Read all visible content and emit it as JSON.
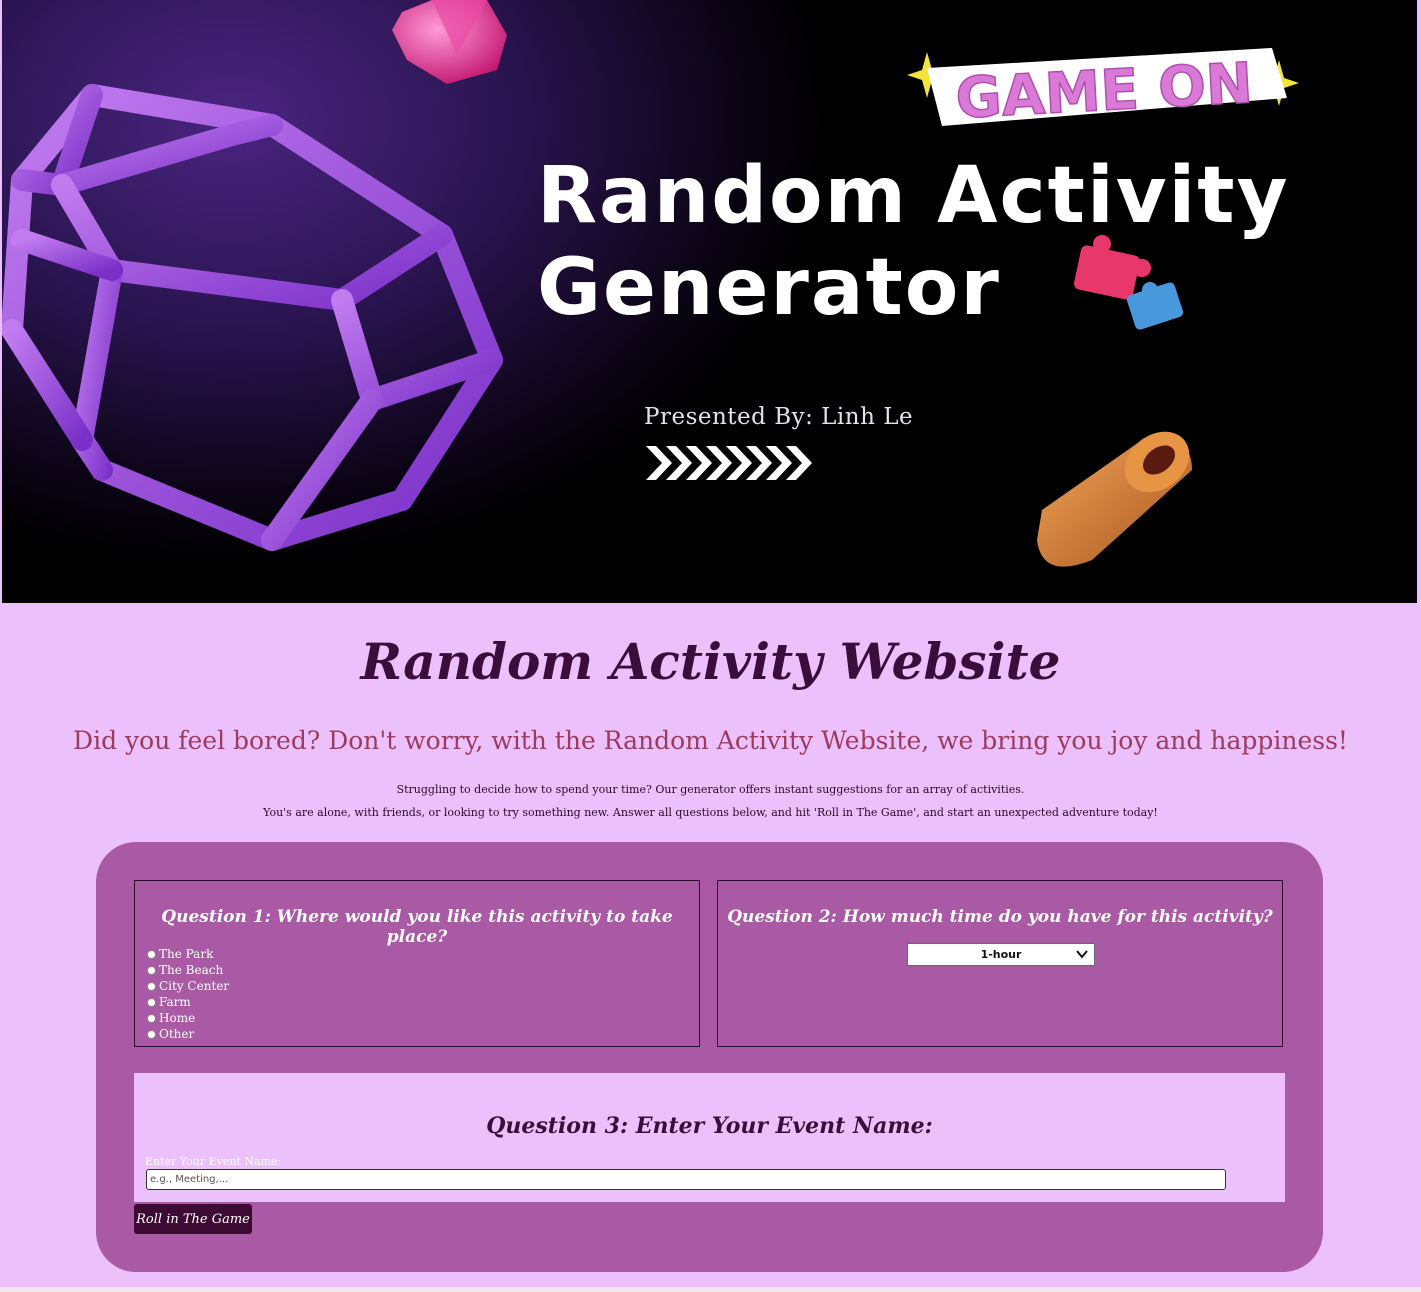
{
  "banner": {
    "sticker_text": "GAME ON",
    "title_line1": "Random Activity",
    "title_line2": "Generator",
    "presented_by": "Presented By: Linh Le"
  },
  "site_title": "Random Activity Website",
  "tagline": "Did you feel bored? Don't worry, with the Random Activity Website, we bring you joy and happiness!",
  "intro_line1": "Struggling to decide how to spend your time? Our generator offers instant suggestions for an array of activities.",
  "intro_line2": "You's are alone, with friends, or looking to try something new. Answer all questions below, and hit 'Roll in The Game', and start an unexpected adventure today!",
  "question1": {
    "heading": "Question 1: Where would you like this activity to take place?",
    "options": [
      "The Park",
      "The Beach",
      "City Center",
      "Farm",
      "Home",
      "Other"
    ]
  },
  "question2": {
    "heading": "Question 2: How much time do you have for this activity?",
    "selected": "1-hour"
  },
  "question3": {
    "heading": "Question 3: Enter Your Event Name:",
    "label": "Enter Your Event Name:",
    "placeholder": "e.g., Meeting,..."
  },
  "submit_label": "Roll in The Game",
  "colors": {
    "page_bg": "#ecc0fb",
    "panel_bg": "#aa5aa5",
    "title_color": "#3b0d3b",
    "tagline_color": "#9b3b5e",
    "button_bg": "#3d0a33"
  }
}
